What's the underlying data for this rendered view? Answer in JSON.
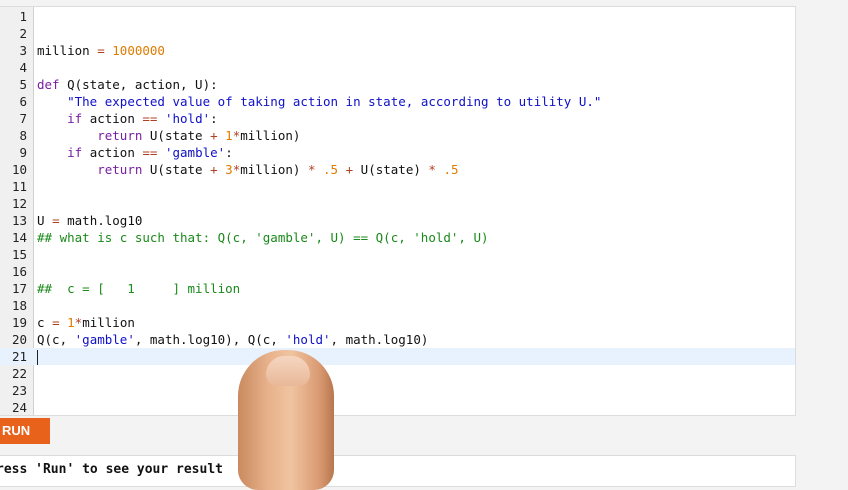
{
  "editor": {
    "lines": [
      {
        "n": "1",
        "code": ""
      },
      {
        "n": "2",
        "code": ""
      },
      {
        "n": "3",
        "code": "million = 1000000"
      },
      {
        "n": "4",
        "code": ""
      },
      {
        "n": "5",
        "code": "def Q(state, action, U):"
      },
      {
        "n": "6",
        "code": "    \"The expected value of taking action in state, according to utility U.\""
      },
      {
        "n": "7",
        "code": "    if action == 'hold':"
      },
      {
        "n": "8",
        "code": "        return U(state + 1*million)"
      },
      {
        "n": "9",
        "code": "    if action == 'gamble':"
      },
      {
        "n": "10",
        "code": "        return U(state + 3*million) * .5 + U(state) * .5"
      },
      {
        "n": "11",
        "code": ""
      },
      {
        "n": "12",
        "code": ""
      },
      {
        "n": "13",
        "code": "U = math.log10"
      },
      {
        "n": "14",
        "code": "## what is c such that: Q(c, 'gamble', U) == Q(c, 'hold', U)"
      },
      {
        "n": "15",
        "code": ""
      },
      {
        "n": "16",
        "code": ""
      },
      {
        "n": "17",
        "code": "##  c = [   1     ] million"
      },
      {
        "n": "18",
        "code": ""
      },
      {
        "n": "19",
        "code": "c = 1*million"
      },
      {
        "n": "20",
        "code": "Q(c, 'gamble', math.log10), Q(c, 'hold', math.log10)"
      },
      {
        "n": "21",
        "code": ""
      },
      {
        "n": "22",
        "code": ""
      },
      {
        "n": "23",
        "code": ""
      },
      {
        "n": "24",
        "code": ""
      }
    ],
    "active_line": "21"
  },
  "run_button": {
    "label": "RUN"
  },
  "output": {
    "text": "ress 'Run' to see your result"
  },
  "colors": {
    "run_button": "#e8621c",
    "keyword": "#7a1fa2",
    "number": "#e07b00",
    "string": "#1010c8",
    "comment": "#1a8a1a"
  }
}
